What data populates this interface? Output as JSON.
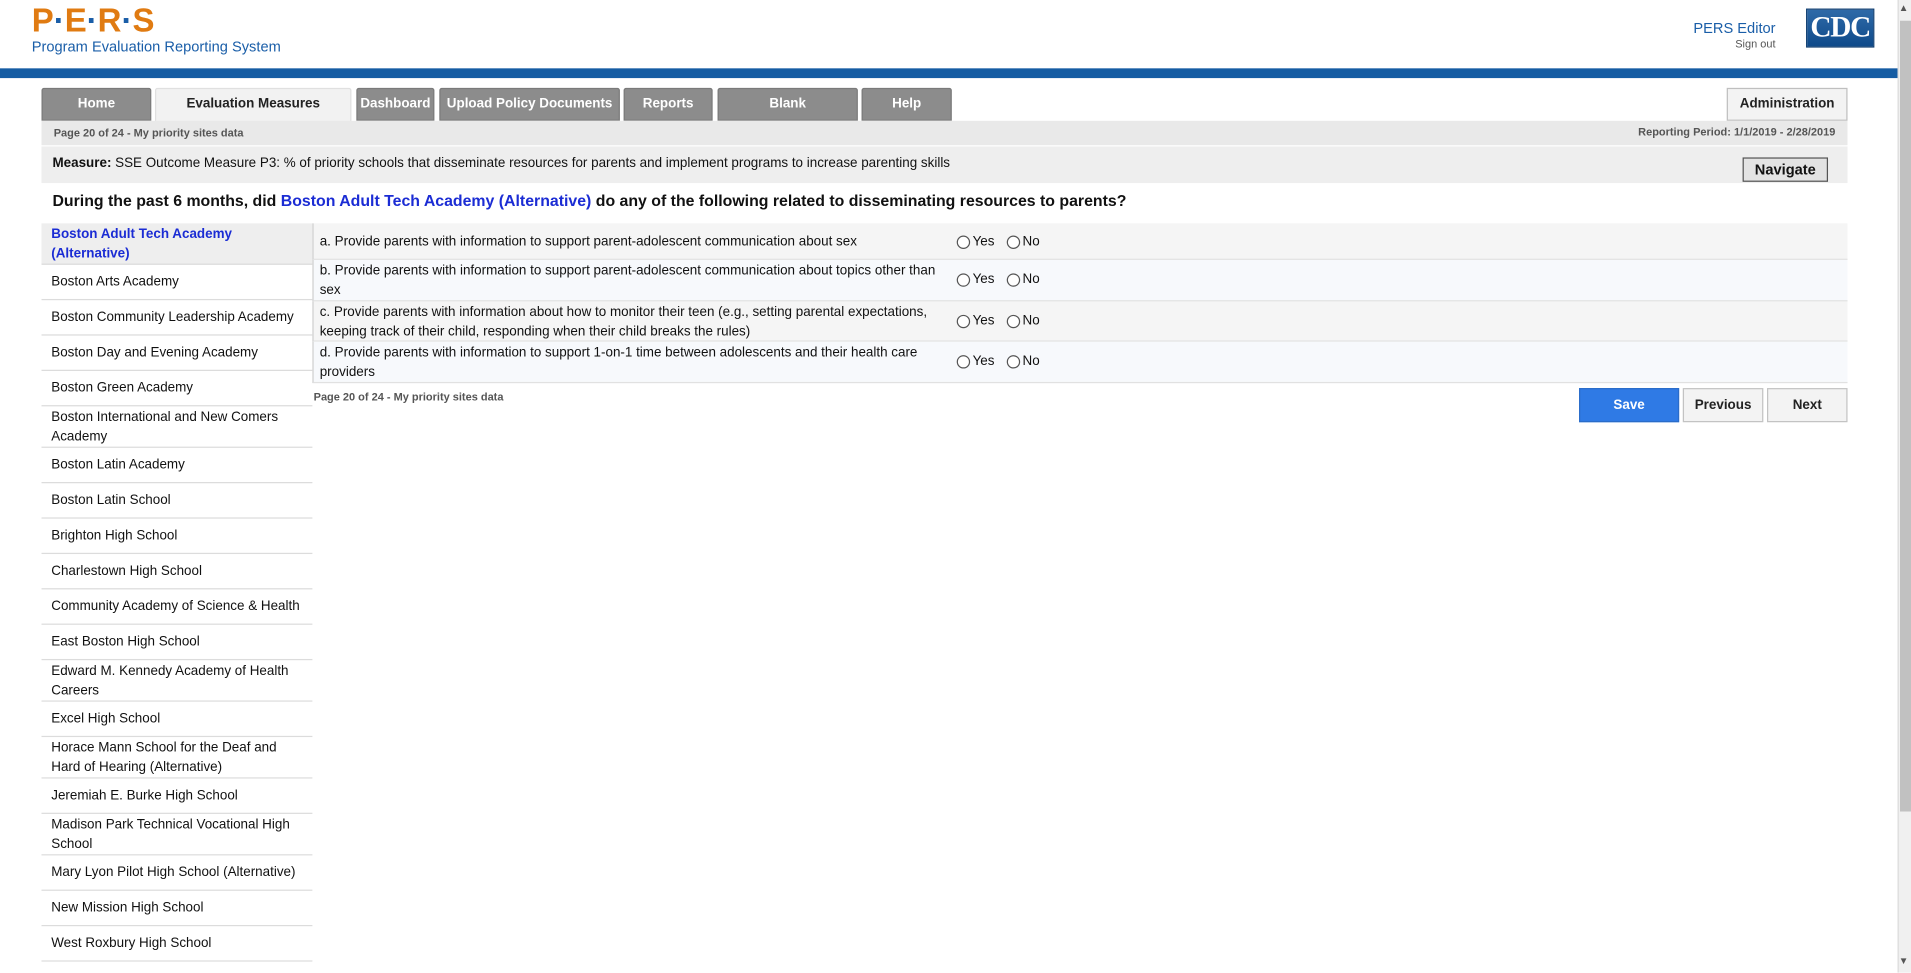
{
  "header": {
    "logo_letters": [
      "P",
      "E",
      "R",
      "S"
    ],
    "logo_subtitle": "Program Evaluation Reporting System",
    "user_name": "PERS Editor",
    "sign_out": "Sign out",
    "agency_logo_text": "CDC"
  },
  "nav": {
    "tabs": [
      {
        "label": "Home",
        "active": false
      },
      {
        "label": "Evaluation Measures Reporting",
        "active": true
      },
      {
        "label": "Dashboard",
        "active": false
      },
      {
        "label": "Upload Policy Documents",
        "active": false
      },
      {
        "label": "Reports",
        "active": false
      },
      {
        "label": "Blank Questionnaires",
        "active": false
      },
      {
        "label": "Help",
        "active": false
      }
    ],
    "admin_label": "Administration"
  },
  "info": {
    "page_status": "Page 20 of 24 - My priority sites data",
    "reporting_period": "Reporting Period: 1/1/2019 - 2/28/2019"
  },
  "measure": {
    "label": "Measure:",
    "text": "SSE Outcome Measure P3: % of priority schools that disseminate resources for parents and implement programs to increase parenting skills",
    "navigate_label": "Navigate"
  },
  "question": {
    "prefix": "During the past 6 months, did",
    "school": "Boston Adult Tech Academy (Alternative)",
    "suffix": "do any of the following related to disseminating resources to parents?"
  },
  "sites": [
    {
      "name": "Boston Adult Tech Academy (Alternative)",
      "selected": true
    },
    {
      "name": "Boston Arts Academy"
    },
    {
      "name": "Boston Community Leadership Academy"
    },
    {
      "name": "Boston Day and Evening Academy"
    },
    {
      "name": "Boston Green Academy"
    },
    {
      "name": "Boston International and New Comers Academy"
    },
    {
      "name": "Boston Latin Academy"
    },
    {
      "name": "Boston Latin School"
    },
    {
      "name": "Brighton High School"
    },
    {
      "name": "Charlestown High School"
    },
    {
      "name": "Community Academy of Science & Health"
    },
    {
      "name": "East Boston High School"
    },
    {
      "name": "Edward M. Kennedy Academy of Health Careers"
    },
    {
      "name": "Excel High School"
    },
    {
      "name": "Horace Mann School for the Deaf and Hard of Hearing (Alternative)"
    },
    {
      "name": "Jeremiah E. Burke High School"
    },
    {
      "name": "Madison Park Technical Vocational High School"
    },
    {
      "name": "Mary Lyon Pilot High School (Alternative)"
    },
    {
      "name": "New Mission High School"
    },
    {
      "name": "West Roxbury High School"
    }
  ],
  "items": [
    {
      "text": "a. Provide parents with information to support parent-adolescent communication about sex",
      "yes": "Yes",
      "no": "No"
    },
    {
      "text": "b. Provide parents with information to support parent-adolescent communication about topics other than sex",
      "yes": "Yes",
      "no": "No"
    },
    {
      "text": "c. Provide parents with information about how to monitor their teen (e.g., setting parental expectations, keeping track of their child, responding when their child breaks the rules)",
      "yes": "Yes",
      "no": "No"
    },
    {
      "text": "d. Provide parents with information to support 1-on-1 time between adolescents and their health care providers",
      "yes": "Yes",
      "no": "No"
    }
  ],
  "footer": {
    "page_status": "Page 20 of 24 - My priority sites data",
    "save_label": "Save",
    "previous_label": "Previous",
    "next_label": "Next"
  },
  "colors": {
    "brand_orange": "#e07b12",
    "brand_blue": "#155ca3",
    "link_blue": "#1b2cd4",
    "save_blue": "#2f7ae5"
  }
}
